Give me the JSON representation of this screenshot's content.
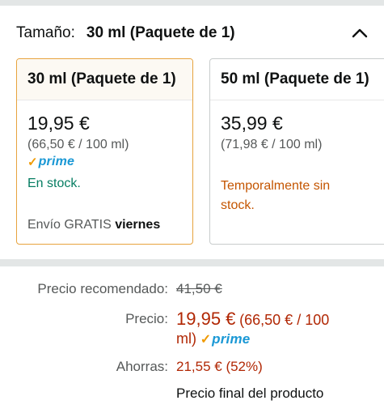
{
  "size_selector": {
    "label": "Tamaño:",
    "selected_value": "30 ml (Paquete de 1)",
    "collapse_icon": "chevron-up-icon"
  },
  "options": [
    {
      "title": "30 ml (Paquete de 1)",
      "price": "19,95 €",
      "unit_price": "(66,50 € / 100 ml)",
      "prime": "prime",
      "availability": "En stock.",
      "delivery_prefix": "Envío GRATIS",
      "delivery_day": "viernes"
    },
    {
      "title": "50 ml (Paquete de 1)",
      "price": "35,99 €",
      "unit_price": "(71,98 € / 100 ml)",
      "availability_line1": "Temporalmente sin",
      "availability_line2": "stock."
    }
  ],
  "pricing": {
    "recommended_label": "Precio recomendado:",
    "recommended_value": "41,50 €",
    "price_label": "Precio:",
    "price_value": "19,95 €",
    "price_unit_line1": "(66,50 € / 100",
    "price_unit_line2": "ml)",
    "prime": "prime",
    "savings_label": "Ahorras:",
    "savings_value": "21,55 € (52%)",
    "final_note": "Precio final del producto"
  },
  "colors": {
    "selected_border": "#e7a33e",
    "price_red": "#b12704",
    "in_stock_green": "#067d62",
    "out_of_stock_orange": "#c45500",
    "prime_blue": "#1a98d5",
    "prime_check": "#f09a00"
  }
}
